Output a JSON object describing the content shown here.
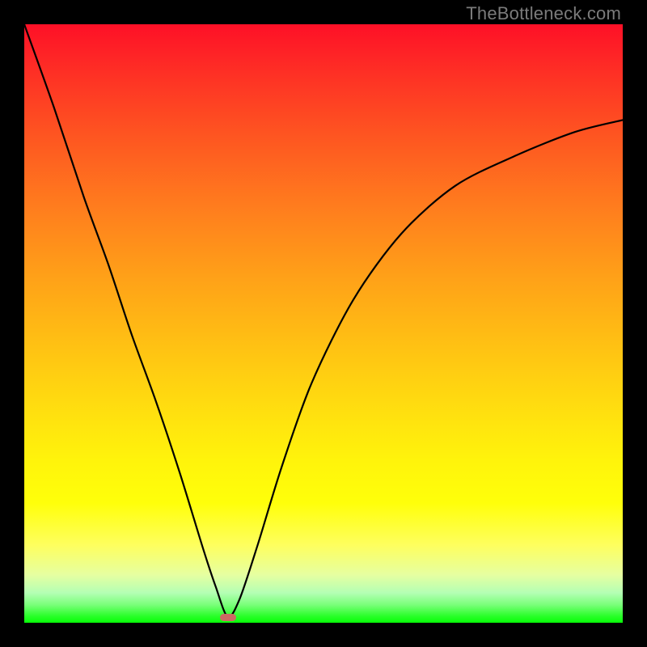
{
  "watermark": {
    "text": "TheBottleneck.com"
  },
  "colors": {
    "page_bg": "#000000",
    "curve_stroke": "#000000",
    "valley_marker": "#cc6a63",
    "watermark_text": "#7b7b7b",
    "gradient_top": "#fe1027",
    "gradient_bottom": "#08ff08"
  },
  "chart_data": {
    "type": "line",
    "title": "",
    "xlabel": "",
    "ylabel": "",
    "xlim": [
      0,
      100
    ],
    "ylim": [
      0,
      100
    ],
    "grid": false,
    "legend": false,
    "annotations": [
      {
        "kind": "marker",
        "shape": "rounded-rect",
        "x": 34,
        "y": 1,
        "color": "#cc6a63"
      }
    ],
    "series": [
      {
        "name": "curve",
        "x": [
          0,
          5,
          10,
          14,
          18,
          22,
          26,
          30,
          32,
          34,
          36,
          39,
          43,
          48,
          55,
          63,
          72,
          82,
          92,
          100
        ],
        "values": [
          100,
          86,
          71,
          60,
          48,
          37,
          25,
          12,
          6,
          1,
          4,
          13,
          26,
          40,
          54,
          65,
          73,
          78,
          82,
          84
        ]
      }
    ],
    "note": "V-shaped bottleneck curve; minimum (~1) occurs near x≈34. Background is a red→green vertical gradient indicating bottleneck severity (higher = worse / red, lower = good / green). Values estimated from pixel positions."
  }
}
